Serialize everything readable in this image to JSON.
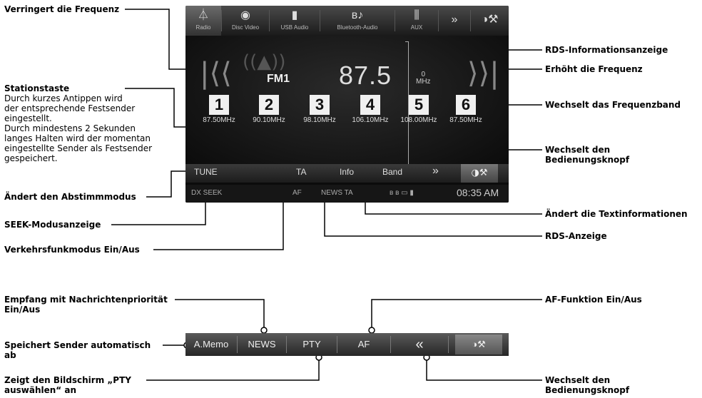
{
  "labels": {
    "decrease": "Verringert die Frequenz",
    "station_title": "Stationstaste",
    "station_desc": [
      "Durch kurzes Antippen wird",
      "der entsprechende Festsender",
      "eingestellt.",
      "Durch mindestens 2 Sekunden",
      "langes Halten wird der momentan",
      "eingestellte Sender als Festsender",
      "gespeichert."
    ],
    "tune_mode": "Ändert den Abstimmmodus",
    "seek_indicator": "SEEK-Modusanzeige",
    "traffic": "Verkehrsfunkmodus Ein/Aus",
    "rds_info": "RDS-Informationsanzeige",
    "increase": "Erhöht die Frequenz",
    "band_change": "Wechselt das Frequenzband",
    "switch_knob": [
      "Wechselt den",
      "Bedienungsknopf"
    ],
    "text_info": "Ändert die Textinformationen",
    "rds_display": "RDS-Anzeige",
    "news_priority": [
      "Empfang mit Nachrichtenpriorität",
      "Ein/Aus"
    ],
    "af_function": "AF-Funktion Ein/Aus",
    "auto_memo": [
      "Speichert Sender automatisch",
      "ab"
    ],
    "pty_screen": [
      "Zeigt den Bildschirm „PTY",
      "auswählen“ an"
    ],
    "switch_knob2": [
      "Wechselt den",
      "Bedienungsknopf"
    ]
  },
  "screen": {
    "tabs": [
      "Radio",
      "Disc Video",
      "USB Audio",
      "Bluetooth-Audio",
      "AUX"
    ],
    "band": "FM1",
    "frequency": "87.5",
    "mhz_top": "0",
    "mhz_unit": "MHz",
    "presets": [
      {
        "num": "1",
        "freq": "87.50MHz"
      },
      {
        "num": "2",
        "freq": "90.10MHz"
      },
      {
        "num": "3",
        "freq": "98.10MHz"
      },
      {
        "num": "4",
        "freq": "106.10MHz"
      },
      {
        "num": "5",
        "freq": "108.00MHz"
      },
      {
        "num": "6",
        "freq": "87.50MHz"
      }
    ],
    "buttons": {
      "tune": "TUNE",
      "ta": "TA",
      "info": "Info",
      "band": "Band",
      "more": "»"
    },
    "status": {
      "seek": "DX SEEK",
      "af": "AF",
      "news_ta": "NEWS TA",
      "time": "08:35 AM"
    }
  },
  "bar2": {
    "amemo": "A.Memo",
    "news": "NEWS",
    "pty": "PTY",
    "af": "AF",
    "back": "«"
  }
}
